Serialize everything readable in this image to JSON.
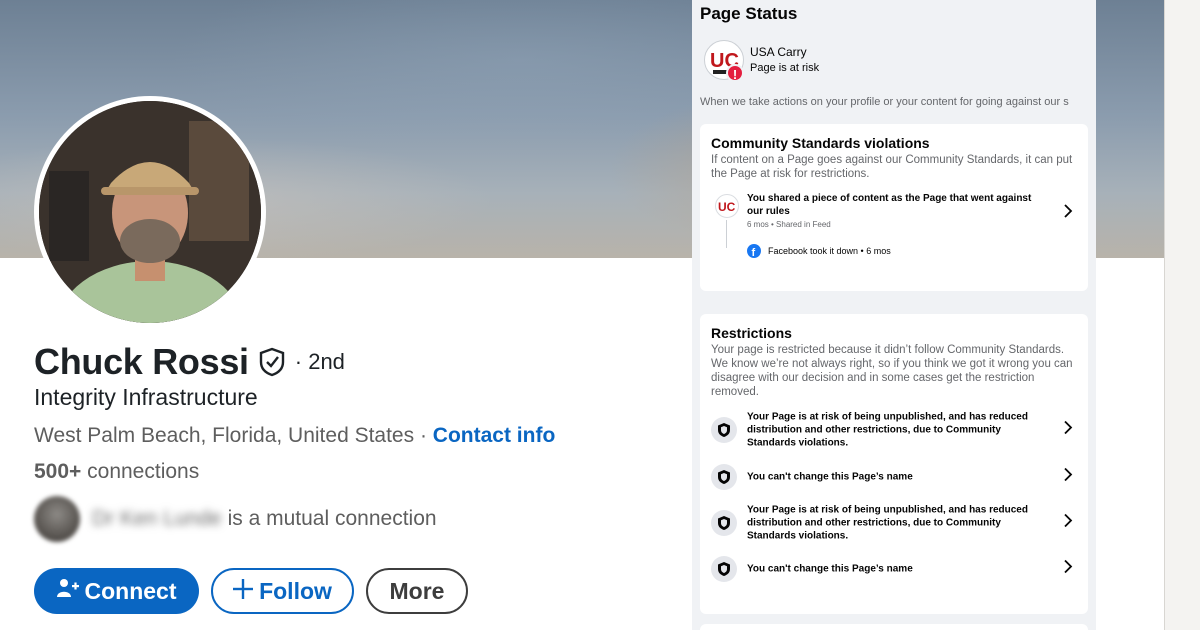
{
  "profile": {
    "name": "Chuck Rossi",
    "degree": "· 2nd",
    "headline": "Integrity Infrastructure",
    "location": "West Palm Beach, Florida, United States",
    "location_separator": " · ",
    "contact_info": "Contact info",
    "connections_count": "500+",
    "connections_label": " connections",
    "mutual_name": "Dr Ken Lunde",
    "mutual_text": "is a mutual connection"
  },
  "actions": {
    "connect": "Connect",
    "follow": "Follow",
    "more": "More"
  },
  "page_status": {
    "title": "Page Status",
    "page_name": "USA Carry",
    "page_state": "Page is at risk",
    "intro": "When we take actions on your profile or your content for going against our s",
    "violations": {
      "title": "Community Standards violations",
      "description": "If content on a Page goes against our Community Standards, it can put the Page at risk for restrictions.",
      "item_text": "You shared a piece of content as the Page that went against our rules",
      "item_meta": "6 mos • Shared in Feed",
      "takedown": "Facebook took it down • 6 mos"
    },
    "restrictions": {
      "title": "Restrictions",
      "description": "Your page is restricted because it didn’t follow Community Standards. We know we’re not always right, so if you think we got it wrong you can disagree with our decision and in some cases get the restriction removed.",
      "items": [
        "Your Page is at risk of being unpublished, and has reduced distribution and other restrictions, due to Community Standards violations.",
        "You can't change this Page’s name",
        "Your Page is at risk of being unpublished, and has reduced distribution and other restrictions, due to Community Standards violations.",
        "You can't change this Page’s name"
      ]
    }
  },
  "colors": {
    "linkedin_blue": "#0a66c2",
    "facebook_blue": "#1877f2",
    "alert_red": "#e41e3f",
    "panel_bg": "#f0f2f5"
  },
  "icons": {
    "verify": "shield-check-icon",
    "connect": "add-person-icon",
    "follow": "plus-icon",
    "restriction": "shield-icon",
    "chevron": "chevron-right-icon",
    "alert": "exclamation-icon",
    "facebook": "facebook-logo-icon"
  }
}
